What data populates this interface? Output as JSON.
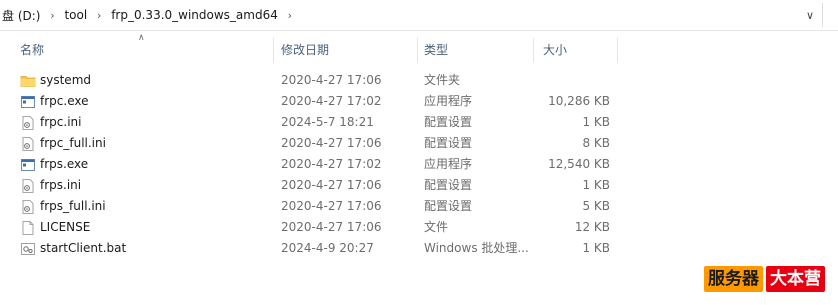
{
  "address": {
    "segments": [
      "盘 (D:)",
      "tool",
      "frp_0.33.0_windows_amd64"
    ]
  },
  "columns": {
    "name": "名称",
    "date": "修改日期",
    "type": "类型",
    "size": "大小"
  },
  "files": [
    {
      "name": "systemd",
      "date": "2020-4-27 17:06",
      "type": "文件夹",
      "size": "",
      "icon": "folder-icon"
    },
    {
      "name": "frpc.exe",
      "date": "2020-4-27 17:02",
      "type": "应用程序",
      "size": "10,286 KB",
      "icon": "exe-icon"
    },
    {
      "name": "frpc.ini",
      "date": "2024-5-7 18:21",
      "type": "配置设置",
      "size": "1 KB",
      "icon": "ini-icon"
    },
    {
      "name": "frpc_full.ini",
      "date": "2020-4-27 17:06",
      "type": "配置设置",
      "size": "8 KB",
      "icon": "ini-icon"
    },
    {
      "name": "frps.exe",
      "date": "2020-4-27 17:02",
      "type": "应用程序",
      "size": "12,540 KB",
      "icon": "exe-icon"
    },
    {
      "name": "frps.ini",
      "date": "2020-4-27 17:06",
      "type": "配置设置",
      "size": "1 KB",
      "icon": "ini-icon"
    },
    {
      "name": "frps_full.ini",
      "date": "2020-4-27 17:06",
      "type": "配置设置",
      "size": "5 KB",
      "icon": "ini-icon"
    },
    {
      "name": "LICENSE",
      "date": "2020-4-27 17:06",
      "type": "文件",
      "size": "12 KB",
      "icon": "file-icon"
    },
    {
      "name": "startClient.bat",
      "date": "2024-4-9 20:27",
      "type": "Windows 批处理...",
      "size": "1 KB",
      "icon": "bat-icon"
    }
  ],
  "watermark": {
    "part1": "服务器",
    "part2": "大本营"
  },
  "colors": {
    "header_text": "#4c607a",
    "folder": "#f6c54a",
    "watermark_orange": "#ff9900",
    "watermark_red": "#e60012"
  }
}
